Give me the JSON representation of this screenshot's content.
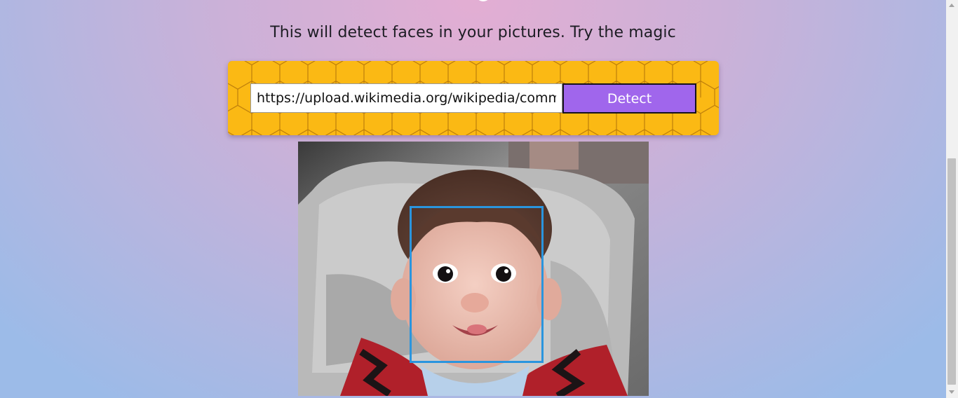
{
  "header": {
    "subtitle": "This will detect faces in your pictures. Try the magic"
  },
  "form": {
    "url_value": "https://upload.wikimedia.org/wikipedia/commons/",
    "detect_label": "Detect"
  },
  "result": {
    "faces_detected": 1
  },
  "colors": {
    "card_background": "#fbb914",
    "button_background": "#a066ec",
    "face_box_border": "#2a95de"
  }
}
